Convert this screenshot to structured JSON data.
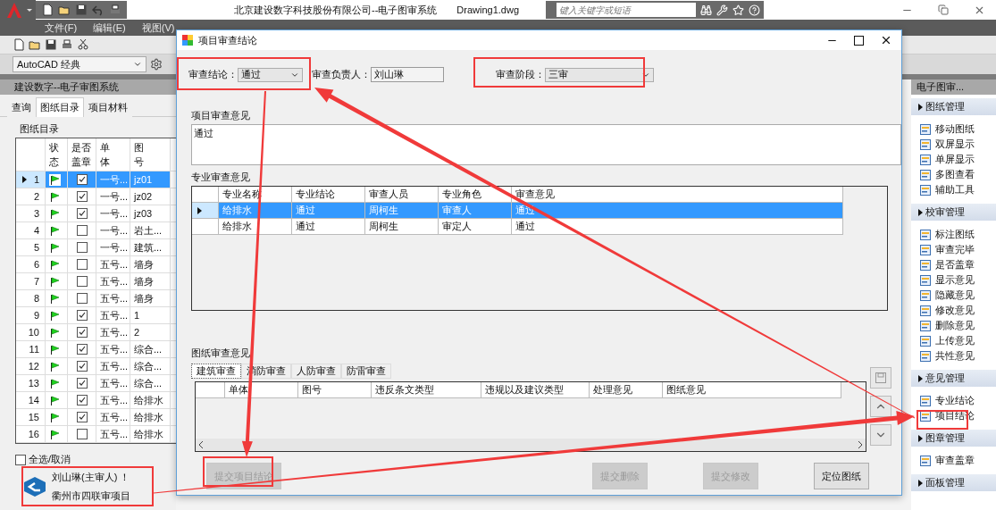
{
  "app": {
    "title": "北京建设数字科技股份有限公司--电子图审系统",
    "file": "Drawing1.dwg",
    "search": {
      "placeholder": "键入关键字或短语"
    },
    "menu": [
      "文件(F)",
      "编辑(E)",
      "视图(V)"
    ],
    "workspace": "AutoCAD 经典"
  },
  "left_panel": {
    "title": "建设数字--电子审图系统",
    "tabs": [
      {
        "label": "查询",
        "selected": false
      },
      {
        "label": "图纸目录",
        "selected": true
      },
      {
        "label": "项目材料",
        "selected": false
      }
    ],
    "group": "图纸目录",
    "columns": [
      "状态",
      "是否盖章",
      "单体",
      "图号"
    ],
    "rows": [
      {
        "num": "1",
        "selected": true,
        "stamped": true,
        "unit": "一号...",
        "drawing": "jz01"
      },
      {
        "num": "2",
        "selected": false,
        "stamped": true,
        "unit": "一号...",
        "drawing": "jz02"
      },
      {
        "num": "3",
        "selected": false,
        "stamped": true,
        "unit": "一号...",
        "drawing": "jz03"
      },
      {
        "num": "4",
        "selected": false,
        "stamped": false,
        "unit": "一号...",
        "drawing": "岩土..."
      },
      {
        "num": "5",
        "selected": false,
        "stamped": false,
        "unit": "一号...",
        "drawing": "建筑..."
      },
      {
        "num": "6",
        "selected": false,
        "stamped": false,
        "unit": "五号...",
        "drawing": "墙身"
      },
      {
        "num": "7",
        "selected": false,
        "stamped": false,
        "unit": "五号...",
        "drawing": "墙身"
      },
      {
        "num": "8",
        "selected": false,
        "stamped": false,
        "unit": "五号...",
        "drawing": "墙身"
      },
      {
        "num": "9",
        "selected": false,
        "stamped": true,
        "unit": "五号...",
        "drawing": "1"
      },
      {
        "num": "10",
        "selected": false,
        "stamped": true,
        "unit": "五号...",
        "drawing": "2"
      },
      {
        "num": "11",
        "selected": false,
        "stamped": true,
        "unit": "五号...",
        "drawing": "综合..."
      },
      {
        "num": "12",
        "selected": false,
        "stamped": true,
        "unit": "五号...",
        "drawing": "综合..."
      },
      {
        "num": "13",
        "selected": false,
        "stamped": true,
        "unit": "五号...",
        "drawing": "综合..."
      },
      {
        "num": "14",
        "selected": false,
        "stamped": true,
        "unit": "五号...",
        "drawing": "给排水"
      },
      {
        "num": "15",
        "selected": false,
        "stamped": true,
        "unit": "五号...",
        "drawing": "给排水"
      },
      {
        "num": "16",
        "selected": false,
        "stamped": false,
        "unit": "五号...",
        "drawing": "给排水"
      }
    ],
    "select_all": {
      "label": "全选/取消",
      "checked": false
    },
    "user": {
      "name": "刘山琳(主审人) ！",
      "project": "衢州市四联审项目"
    }
  },
  "right_panel": {
    "title": "电子图审...",
    "sections": [
      {
        "title": "图纸管理",
        "items": [
          "移动图纸",
          "双屏显示",
          "单屏显示",
          "多图查看",
          "辅助工具"
        ]
      },
      {
        "title": "校审管理",
        "items": [
          "标注图纸",
          "审查完毕",
          "是否盖章",
          "显示意见",
          "隐藏意见",
          "修改意见",
          "删除意见",
          "上传意见",
          "共性意见"
        ]
      },
      {
        "title": "意见管理",
        "items": [
          "专业结论",
          "项目结论"
        ]
      },
      {
        "title": "图章管理",
        "items": [
          "审查盖章"
        ]
      },
      {
        "title": "面板管理"
      }
    ]
  },
  "dialog": {
    "title": "项目审查结论",
    "conclusion": {
      "label": "审查结论：",
      "value": "通过"
    },
    "reviewer": {
      "label": "审查负责人：",
      "value": "刘山琳"
    },
    "stage": {
      "label": "审查阶段：",
      "value": "三审"
    },
    "project_opinion": {
      "label": "项目审查意见",
      "value": "通过"
    },
    "discipline_opinions": {
      "label": "专业审查意见",
      "columns": [
        "专业名称",
        "专业结论",
        "审查人员",
        "专业角色",
        "审查意见"
      ],
      "rows": [
        {
          "selected": true,
          "cells": [
            "给排水",
            "通过",
            "周柯生",
            "审查人",
            "通过"
          ]
        },
        {
          "selected": false,
          "cells": [
            "给排水",
            "通过",
            "周柯生",
            "审定人",
            "通过"
          ]
        }
      ]
    },
    "drawing_opinions": {
      "label": "图纸审查意见",
      "tabs": [
        {
          "label": "建筑审查",
          "selected": true
        },
        {
          "label": "消防审查",
          "selected": false
        },
        {
          "label": "人防审查",
          "selected": false
        },
        {
          "label": "防雷审查",
          "selected": false
        }
      ],
      "columns": [
        "单体",
        "图号",
        "违反条文类型",
        "违规以及建议类型",
        "处理意见",
        "图纸意见"
      ]
    },
    "buttons": [
      {
        "label": "提交项目结论",
        "disabled": true
      },
      {
        "label": "提交删除",
        "disabled": true
      },
      {
        "label": "提交修改",
        "disabled": true
      },
      {
        "label": "定位图纸",
        "disabled": false
      }
    ]
  }
}
